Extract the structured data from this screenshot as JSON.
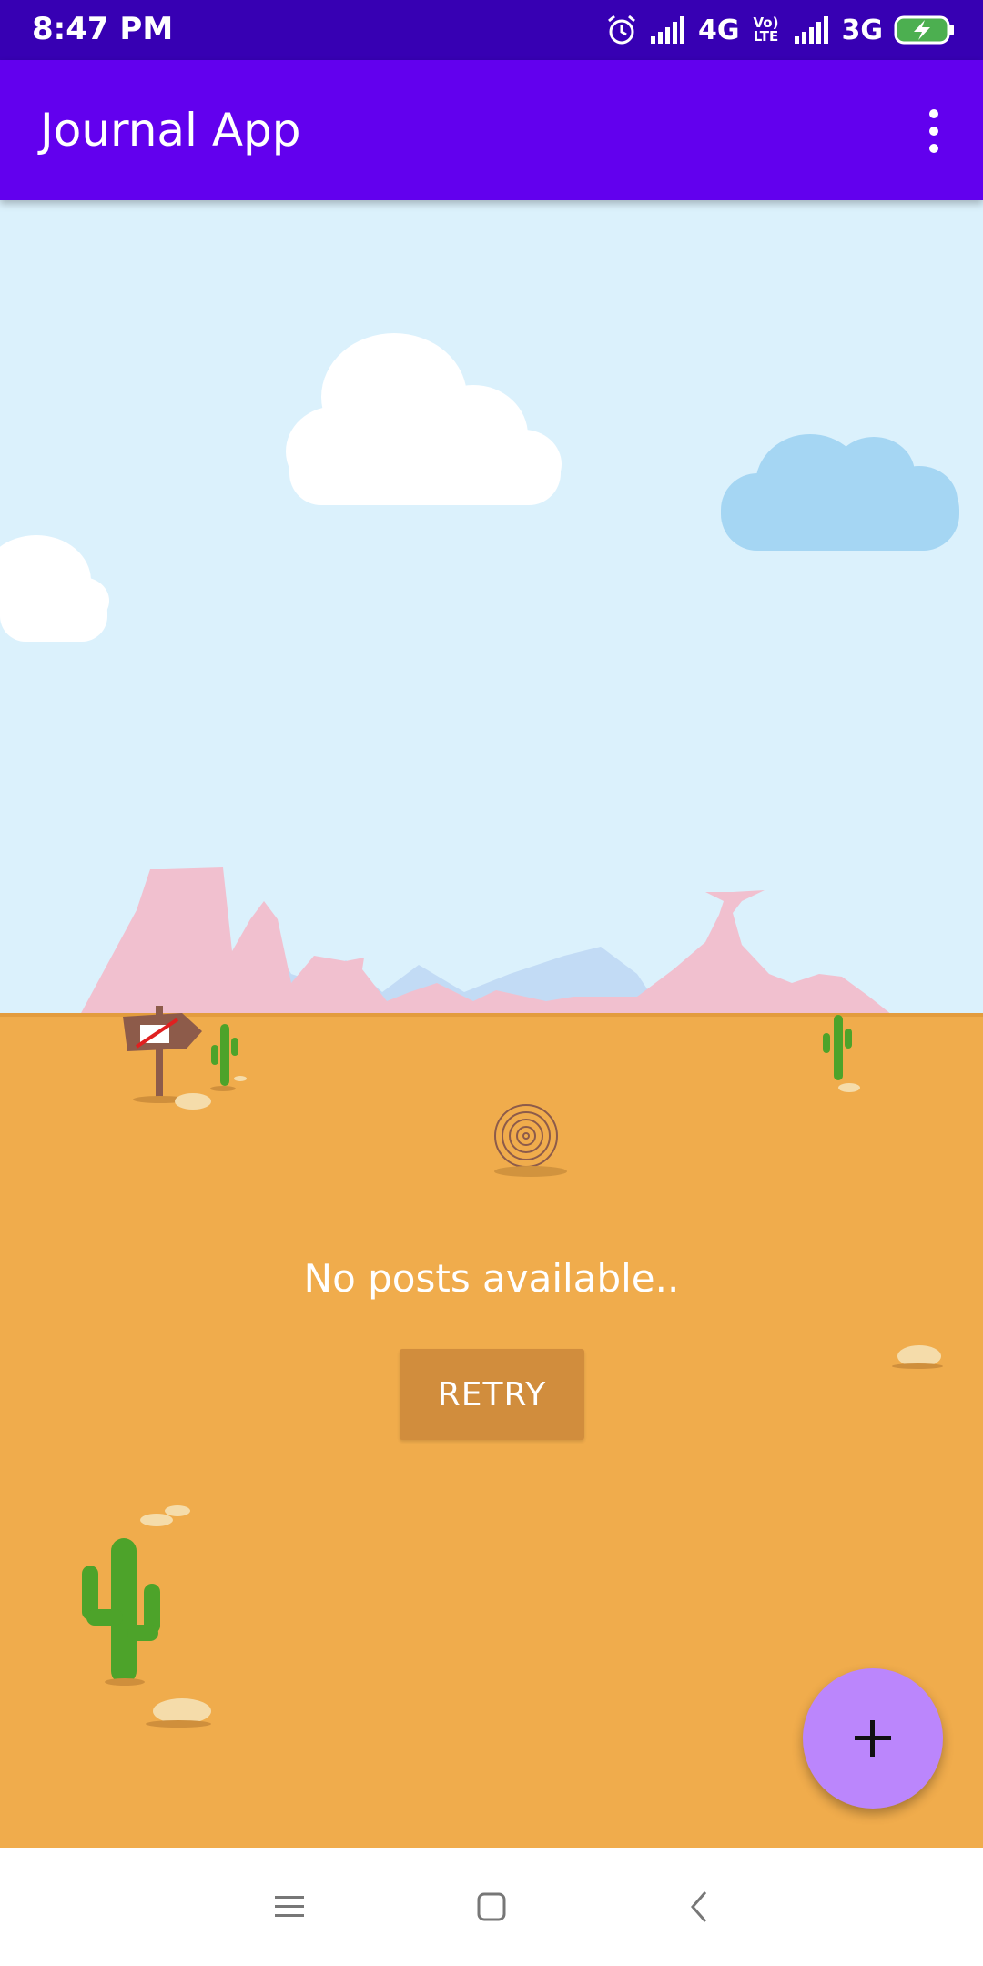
{
  "status_bar": {
    "time": "8:47 PM",
    "network_1": "4G",
    "volte": "Vo) LTE",
    "network_2": "3G",
    "icons": [
      "alarm-icon",
      "signal-icon",
      "volte-icon",
      "signal-icon",
      "battery-charging-icon"
    ]
  },
  "app_bar": {
    "title": "Journal App",
    "menu_icon": "more-vert-icon"
  },
  "empty_state": {
    "message": "No posts available..",
    "retry_label": "RETRY"
  },
  "fab": {
    "icon": "plus-icon"
  },
  "nav_bar": {
    "icons": [
      "menu-icon",
      "home-icon",
      "back-icon"
    ]
  },
  "colors": {
    "status_bar": "#3700b3",
    "app_bar": "#6200ee",
    "sky": "#dbf1fc",
    "sand": "#f0ac4c",
    "retry_button": "#d18d3d",
    "fab": "#bb86fc"
  }
}
